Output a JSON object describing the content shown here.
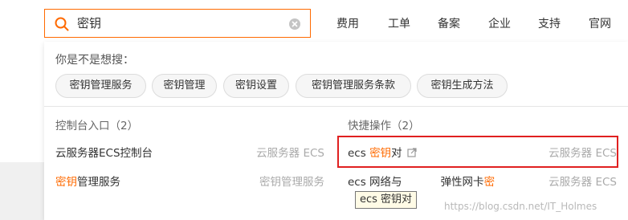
{
  "search": {
    "value": "密钥"
  },
  "nav": [
    "费用",
    "工单",
    "备案",
    "企业",
    "支持",
    "官网"
  ],
  "suggest": {
    "label": "你是不是想搜：",
    "chips": [
      "密钥管理服务",
      "密钥管理",
      "密钥设置",
      "密钥管理服务条款",
      "密钥生成方法"
    ]
  },
  "console": {
    "title": "控制台入口（2）",
    "rows": [
      {
        "pre": "",
        "hl": "",
        "post": "云服务器ECS控制台",
        "category": "云服务器 ECS"
      },
      {
        "pre": "",
        "hl": "密钥",
        "post": "管理服务",
        "category": "密钥管理服务"
      }
    ]
  },
  "shortcut": {
    "title": "快捷操作（2）",
    "rows": [
      {
        "pre": "ecs ",
        "hl": "密钥",
        "post": "对",
        "category": "云服务器 ECS"
      },
      {
        "pre": "ecs 网络与",
        "mid": "弹性网卡",
        "hl": "密",
        "category": "云服务器 ECS"
      }
    ]
  },
  "tooltip": "ecs 密钥对",
  "watermark": "https://blog.csdn.net/IT_Holmes",
  "colors": {
    "accent": "#ff6a00",
    "highlight_box": "#e02020",
    "category_text": "#aaaaaa"
  }
}
